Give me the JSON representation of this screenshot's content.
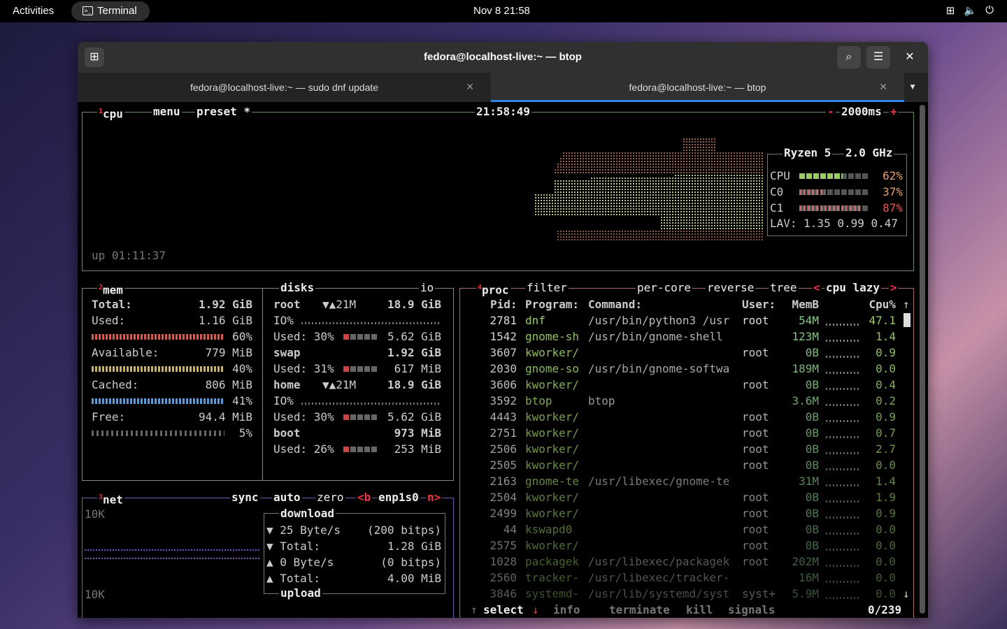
{
  "topbar": {
    "activities": "Activities",
    "app": "Terminal",
    "clock": "Nov 8  21:58"
  },
  "window": {
    "title": "fedora@localhost-live:~ — btop",
    "tabs": [
      {
        "label": "fedora@localhost-live:~ — sudo dnf update",
        "active": false
      },
      {
        "label": "fedora@localhost-live:~ — btop",
        "active": true
      }
    ]
  },
  "btop": {
    "cpu": {
      "num": "1",
      "title": "cpu",
      "menu": "menu",
      "preset": "preset *",
      "time": "21:58:49",
      "interval": "2000ms",
      "minus": "-",
      "plus": "+",
      "uptime": "up 01:11:37",
      "model": "Ryzen 5",
      "freq": "2.0 GHz",
      "rows": [
        {
          "name": "CPU",
          "pct": "62%",
          "fill": 0.62
        },
        {
          "name": "C0",
          "pct": "37%",
          "fill": 0.37
        },
        {
          "name": "C1",
          "pct": "87%",
          "fill": 0.87
        }
      ],
      "lav": "LAV: 1.35 0.99 0.47"
    },
    "mem": {
      "num": "2",
      "title": "mem",
      "total_label": "Total:",
      "total": "1.92 GiB",
      "used_label": "Used:",
      "used": "1.16 GiB",
      "used_pct": "60%",
      "avail_label": "Available:",
      "avail": "779 MiB",
      "avail_pct": "40%",
      "cached_label": "Cached:",
      "cached": "806 MiB",
      "cached_pct": "41%",
      "free_label": "Free:",
      "free": "94.4 MiB",
      "free_pct": "5%"
    },
    "disks": {
      "title": "disks",
      "io": "io",
      "items": [
        {
          "name": "root",
          "io_rate": "▼▲21M",
          "size": "18.9 GiB",
          "io": "IO%",
          "used": "Used: 30%",
          "used_val": "5.62 GiB"
        },
        {
          "name": "swap",
          "io_rate": "",
          "size": "1.92 GiB",
          "io": "",
          "used": "Used: 31%",
          "used_val": "617 MiB"
        },
        {
          "name": "home",
          "io_rate": "▼▲21M",
          "size": "18.9 GiB",
          "io": "IO%",
          "used": "Used: 30%",
          "used_val": "5.62 GiB"
        },
        {
          "name": "boot",
          "io_rate": "",
          "size": "973 MiB",
          "io": "",
          "used": "Used: 26%",
          "used_val": "253 MiB"
        }
      ]
    },
    "net": {
      "num": "3",
      "title": "net",
      "sync": "sync",
      "auto": "auto",
      "zero": "zero",
      "iface_prev": "<b",
      "iface": "enp1s0",
      "iface_next": "n>",
      "scale_top": "10K",
      "scale_bottom": "10K",
      "download": "download",
      "down_rate": "▼ 25 Byte/s",
      "down_bits": "(200 bitps)",
      "down_total_label": "▼ Total:",
      "down_total": "1.28 GiB",
      "up_rate": "▲ 0 Byte/s",
      "up_bits": "(0 bitps)",
      "up_total_label": "▲ Total:",
      "up_total": "4.00 MiB",
      "upload": "upload"
    },
    "proc": {
      "num": "4",
      "title": "proc",
      "filter": "filter",
      "per_core": "per-core",
      "reverse": "reverse",
      "tree": "tree",
      "sort_prev": "<",
      "sort": "cpu lazy",
      "sort_next": ">",
      "headers": {
        "pid": "Pid:",
        "program": "Program:",
        "command": "Command:",
        "user": "User:",
        "mem": "MemB",
        "cpu": "Cpu%"
      },
      "rows": [
        {
          "pid": "2781",
          "program": "dnf",
          "command": "/usr/bin/python3 /usr",
          "user": "root",
          "mem": "54M",
          "cpu": "47.1"
        },
        {
          "pid": "1542",
          "program": "gnome-sh",
          "command": "/usr/bin/gnome-shell",
          "user": "",
          "mem": "123M",
          "cpu": "1.4"
        },
        {
          "pid": "3607",
          "program": "kworker/",
          "command": "",
          "user": "root",
          "mem": "0B",
          "cpu": "0.9"
        },
        {
          "pid": "2030",
          "program": "gnome-so",
          "command": "/usr/bin/gnome-softwa",
          "user": "",
          "mem": "189M",
          "cpu": "0.0"
        },
        {
          "pid": "3606",
          "program": "kworker/",
          "command": "",
          "user": "root",
          "mem": "0B",
          "cpu": "0.4"
        },
        {
          "pid": "3592",
          "program": "btop",
          "command": "btop",
          "user": "",
          "mem": "3.6M",
          "cpu": "0.2"
        },
        {
          "pid": "4443",
          "program": "kworker/",
          "command": "",
          "user": "root",
          "mem": "0B",
          "cpu": "0.9"
        },
        {
          "pid": "2751",
          "program": "kworker/",
          "command": "",
          "user": "root",
          "mem": "0B",
          "cpu": "0.7"
        },
        {
          "pid": "2506",
          "program": "kworker/",
          "command": "",
          "user": "root",
          "mem": "0B",
          "cpu": "2.7"
        },
        {
          "pid": "2505",
          "program": "kworker/",
          "command": "",
          "user": "root",
          "mem": "0B",
          "cpu": "0.0"
        },
        {
          "pid": "2163",
          "program": "gnome-te",
          "command": "/usr/libexec/gnome-te",
          "user": "",
          "mem": "31M",
          "cpu": "1.4"
        },
        {
          "pid": "2504",
          "program": "kworker/",
          "command": "",
          "user": "root",
          "mem": "0B",
          "cpu": "1.9"
        },
        {
          "pid": "2499",
          "program": "kworker/",
          "command": "",
          "user": "root",
          "mem": "0B",
          "cpu": "0.9"
        },
        {
          "pid": "44",
          "program": "kswapd0",
          "command": "",
          "user": "root",
          "mem": "0B",
          "cpu": "0.0"
        },
        {
          "pid": "2575",
          "program": "kworker/",
          "command": "",
          "user": "root",
          "mem": "0B",
          "cpu": "0.0"
        },
        {
          "pid": "1028",
          "program": "packagek",
          "command": "/usr/libexec/packagek",
          "user": "root",
          "mem": "202M",
          "cpu": "0.0"
        },
        {
          "pid": "2560",
          "program": "tracker-",
          "command": "/usr/libexec/tracker-",
          "user": "",
          "mem": "16M",
          "cpu": "0.0"
        },
        {
          "pid": "3846",
          "program": "systemd-",
          "command": "/usr/lib/systemd/syst",
          "user": "syst+",
          "mem": "5.9M",
          "cpu": "0.0"
        }
      ],
      "footer": {
        "select": "select",
        "info": "info",
        "terminate": "terminate",
        "kill": "kill",
        "signals": "signals",
        "count": "0/239"
      }
    }
  }
}
